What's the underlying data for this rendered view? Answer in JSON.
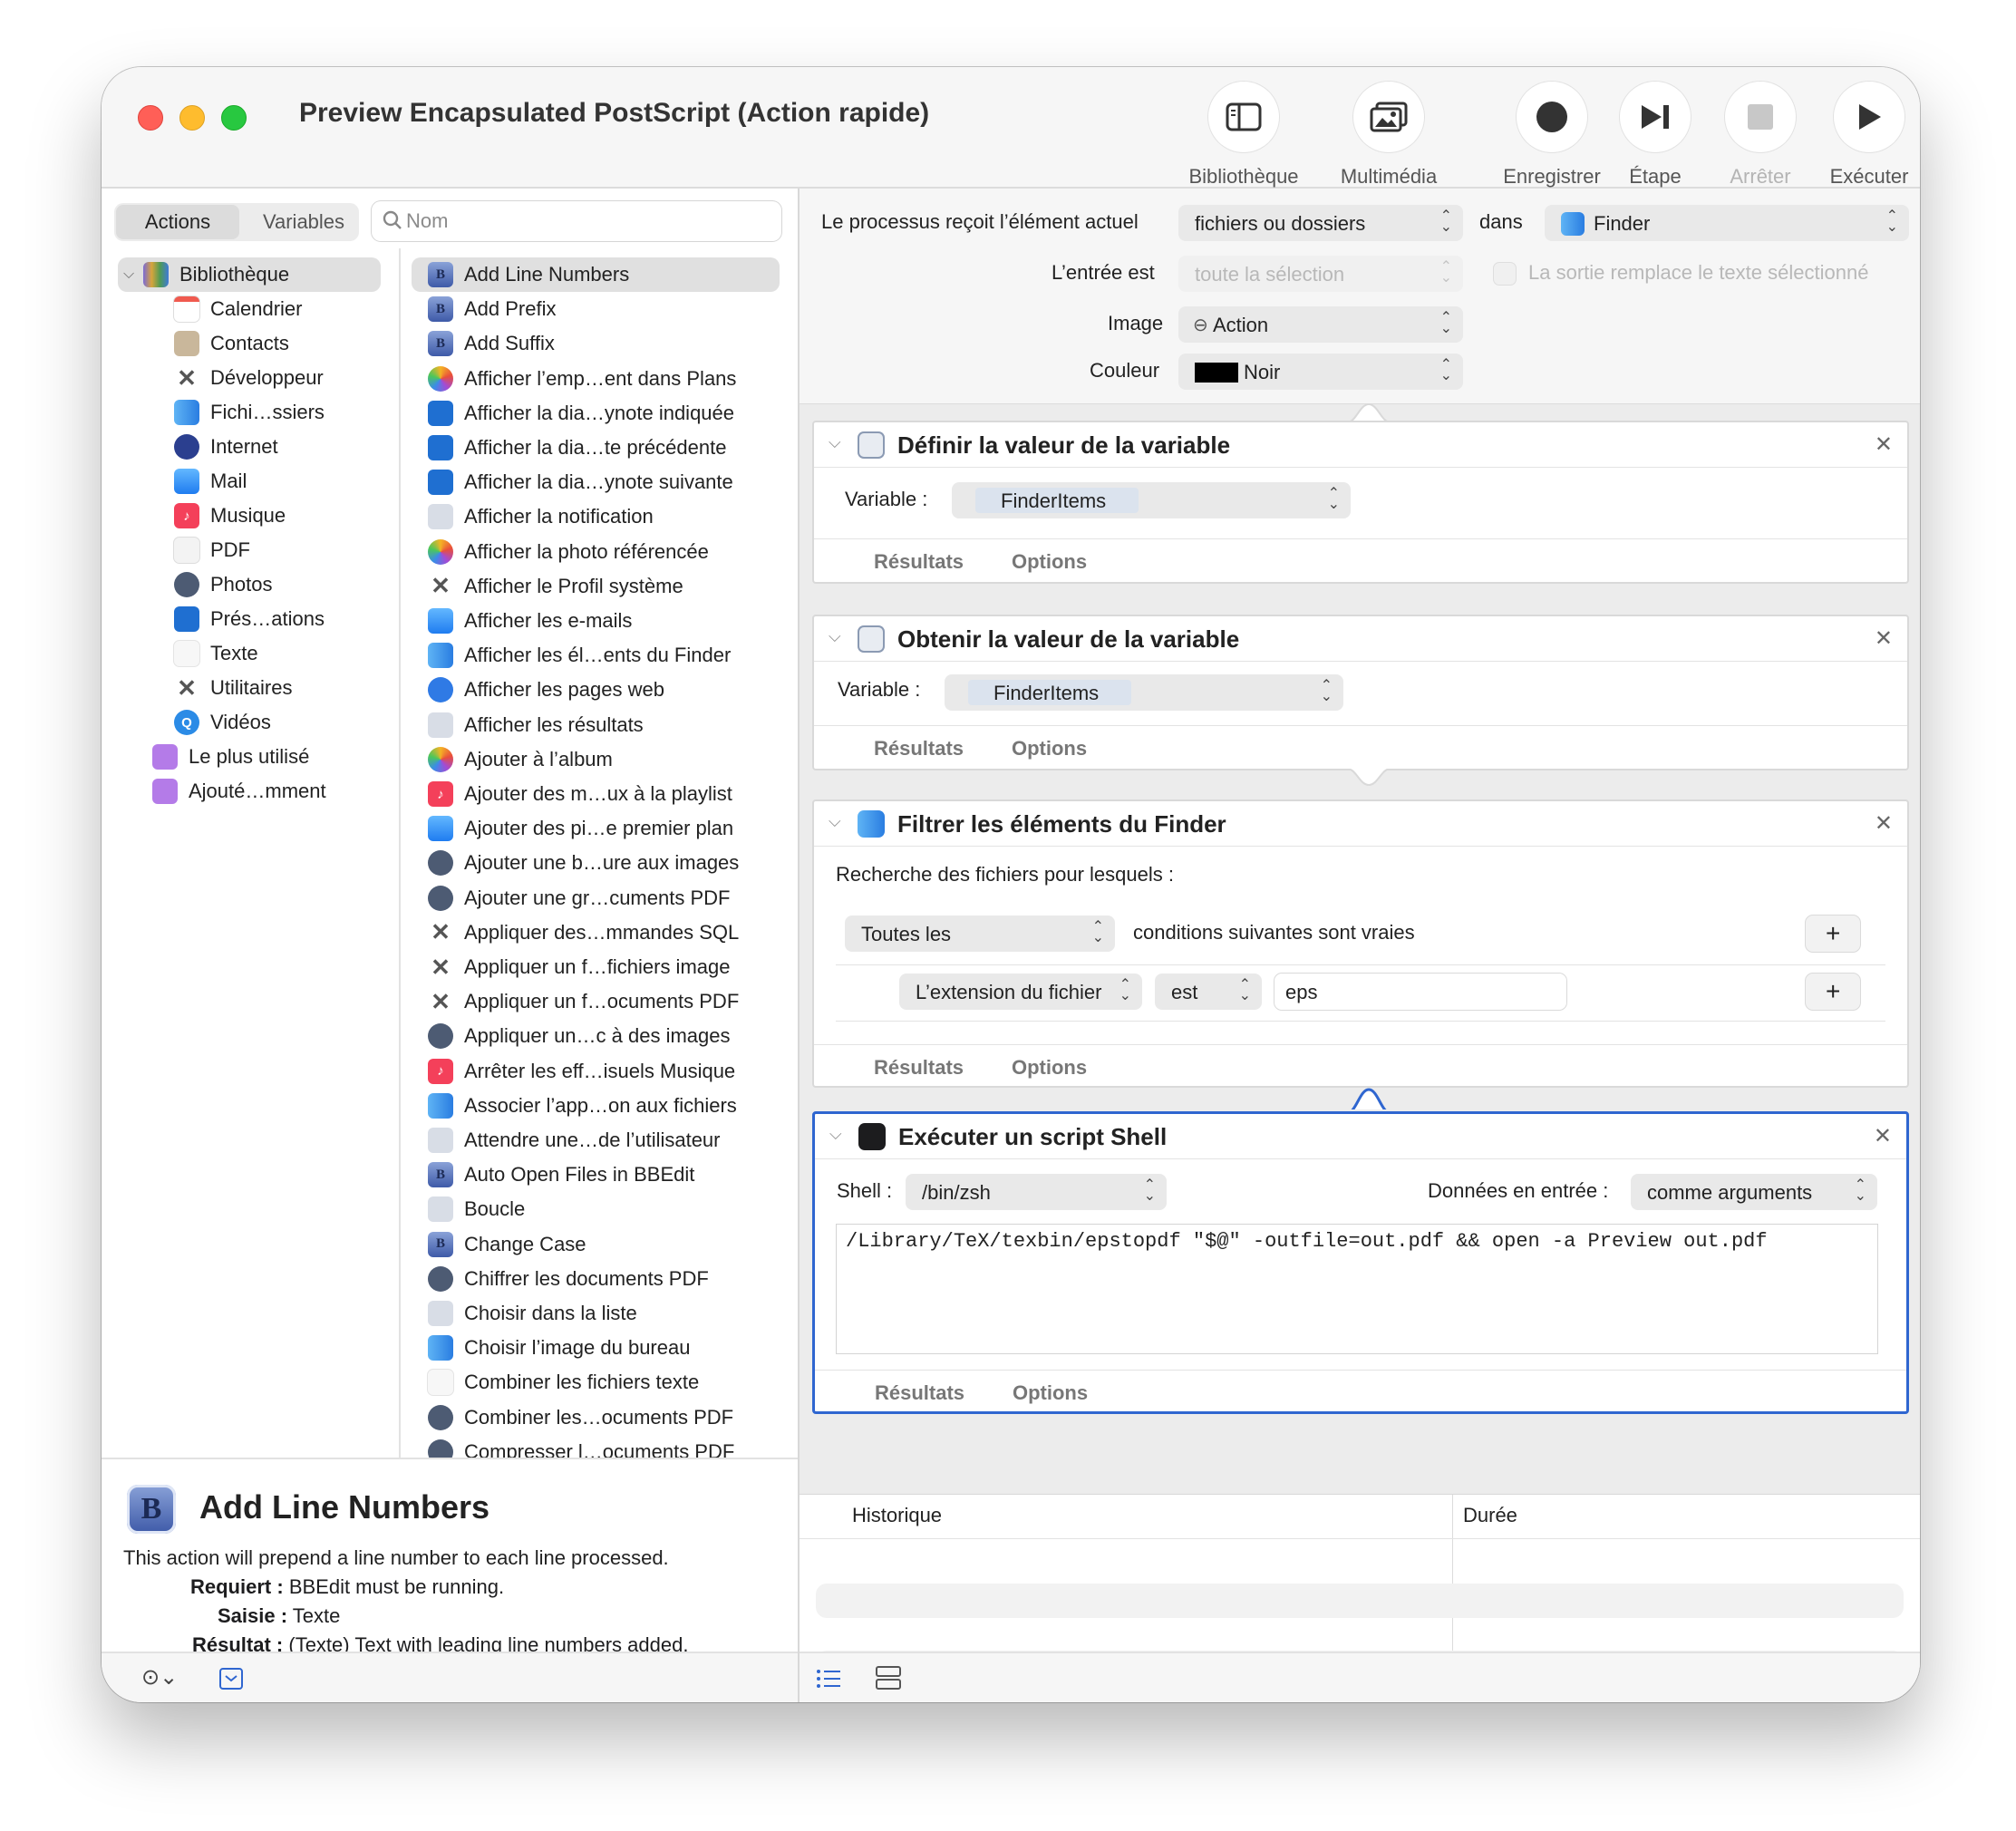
{
  "window": {
    "title": "Preview Encapsulated PostScript (Action rapide)"
  },
  "toolbar": {
    "library": "Bibliothèque",
    "media": "Multimédia",
    "record": "Enregistrer",
    "step": "Étape",
    "stop": "Arrêter",
    "run": "Exécuter"
  },
  "left": {
    "tab_actions": "Actions",
    "tab_variables": "Variables",
    "search_placeholder": "Nom",
    "library_root": "Bibliothèque",
    "library_items": [
      "Calendrier",
      "Contacts",
      "Développeur",
      "Fichi…ssiers",
      "Internet",
      "Mail",
      "Musique",
      "PDF",
      "Photos",
      "Prés…ations",
      "Texte",
      "Utilitaires",
      "Vidéos"
    ],
    "library_extra": [
      "Le plus utilisé",
      "Ajouté…mment"
    ],
    "actions": [
      "Add Line Numbers",
      "Add Prefix",
      "Add Suffix",
      "Afficher l’emp…ent dans Plans",
      "Afficher la dia…ynote indiquée",
      "Afficher la dia…te précédente",
      "Afficher la dia…ynote suivante",
      "Afficher la notification",
      "Afficher la photo référencée",
      "Afficher le Profil système",
      "Afficher les e-mails",
      "Afficher les él…ents du Finder",
      "Afficher les pages web",
      "Afficher les résultats",
      "Ajouter à l’album",
      "Ajouter des m…ux à la playlist",
      "Ajouter des pi…e premier plan",
      "Ajouter une b…ure aux images",
      "Ajouter une gr…cuments PDF",
      "Appliquer des…mmandes SQL",
      "Appliquer un f…fichiers image",
      "Appliquer un f…ocuments PDF",
      "Appliquer un…c à des images",
      "Arrêter les eff…isuels Musique",
      "Associer l’app…on aux fichiers",
      "Attendre une…de l’utilisateur",
      "Auto Open Files in BBEdit",
      "Boucle",
      "Change Case",
      "Chiffrer les documents PDF",
      "Choisir dans la liste",
      "Choisir l’image du bureau",
      "Combiner les fichiers texte",
      "Combiner les…ocuments PDF",
      "Compresser l…ocuments PDF"
    ],
    "description": {
      "title": "Add Line Numbers",
      "text": "This action will prepend a line number to each line processed.",
      "requires_label": "Requiert :",
      "requires_value": "BBEdit must be running.",
      "input_label": "Saisie :",
      "input_value": "Texte",
      "result_label": "Résultat :",
      "result_value": "(Texte) Text with leading line numbers added."
    }
  },
  "process": {
    "receives_label": "Le processus reçoit l’élément actuel",
    "receives_value": "fichiers ou dossiers",
    "in_label": "dans",
    "in_value": "Finder",
    "input_is_label": "L’entrée est",
    "input_is_value": "toute la sélection",
    "replace_label": "La sortie remplace le texte sélectionné",
    "image_label": "Image",
    "image_value": "Action",
    "color_label": "Couleur",
    "color_value": "Noir"
  },
  "actions": [
    {
      "title": "Définir la valeur de la variable",
      "var_label": "Variable :",
      "var_value": "FinderItems",
      "tab1": "Résultats",
      "tab2": "Options"
    },
    {
      "title": "Obtenir la valeur de la variable",
      "var_label": "Variable :",
      "var_value": "FinderItems",
      "tab1": "Résultats",
      "tab2": "Options"
    },
    {
      "title": "Filtrer les éléments du Finder",
      "intro": "Recherche des fichiers pour lesquels :",
      "match": "Toutes les",
      "match_suffix": "conditions suivantes sont vraies",
      "field": "L’extension du fichier",
      "op": "est",
      "value": "eps",
      "tab1": "Résultats",
      "tab2": "Options"
    },
    {
      "title": "Exécuter un script Shell",
      "shell_label": "Shell :",
      "shell_value": "/bin/zsh",
      "input_label": "Données en entrée :",
      "input_value": "comme arguments",
      "script": "/Library/TeX/texbin/epstopdf \"$@\" -outfile=out.pdf && open -a Preview out.pdf",
      "tab1": "Résultats",
      "tab2": "Options"
    }
  ],
  "log": {
    "history": "Historique",
    "duration": "Durée"
  },
  "colors": {
    "accent": "#2f66d0",
    "red": "#ff5f57",
    "yellow": "#febc2e",
    "green": "#28c840"
  }
}
